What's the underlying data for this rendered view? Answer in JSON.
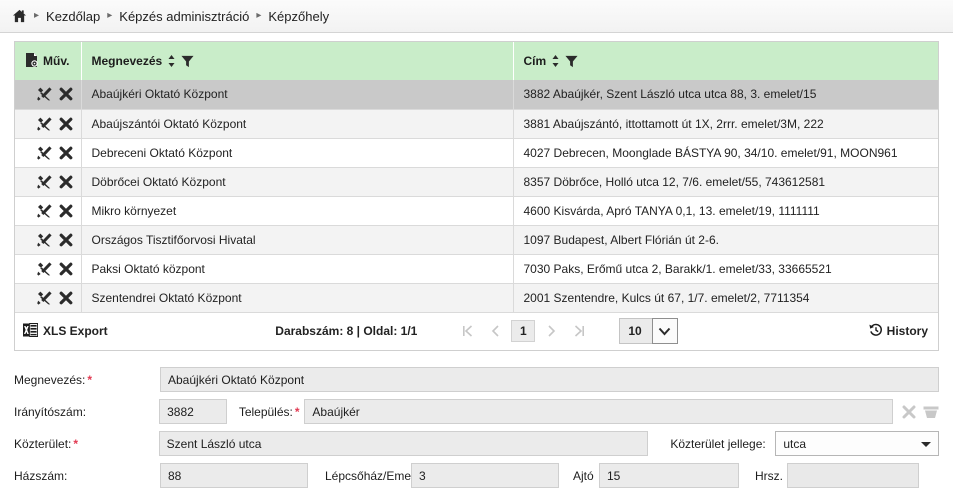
{
  "breadcrumb": {
    "home_icon": "home-icon",
    "items": [
      "Kezdőlap",
      "Képzés adminisztráció",
      "Képzőhely"
    ]
  },
  "grid": {
    "columns": [
      {
        "label": "Műv.",
        "icon": "page-settings-icon",
        "sortable": false,
        "filterable": false
      },
      {
        "label": "Megnevezés",
        "sortable": true,
        "filterable": true
      },
      {
        "label": "Cím",
        "sortable": true,
        "filterable": true
      }
    ],
    "row_actions": [
      "edit-tools-icon",
      "delete-x-icon"
    ],
    "rows": [
      {
        "name": "Abaújkéri Oktató Központ",
        "address": "3882 Abaújkér, Szent László utca utca 88, 3. emelet/15",
        "selected": true
      },
      {
        "name": "Abaújszántói Oktató Központ",
        "address": "3881 Abaújszántó, ittottamott út 1X, 2rrr. emelet/3M, 222",
        "selected": false
      },
      {
        "name": "Debreceni Oktató Központ",
        "address": "4027 Debrecen, Moonglade BÁSTYA 90, 34/10. emelet/91, MOON961",
        "selected": false
      },
      {
        "name": "Döbrőcei Oktató Központ",
        "address": "8357 Döbrőce, Holló utca 12, 7/6. emelet/55, 743612581",
        "selected": false
      },
      {
        "name": "Mikro környezet",
        "address": "4600 Kisvárda, Apró TANYA 0,1, 13. emelet/19, 1111111",
        "selected": false
      },
      {
        "name": "Országos Tisztifőorvosi Hivatal",
        "address": "1097 Budapest, Albert Flórián út 2-6.",
        "selected": false
      },
      {
        "name": "Paksi Oktató központ",
        "address": "7030 Paks, Erőmű utca 2, Barakk/1. emelet/33, 33665521",
        "selected": false
      },
      {
        "name": "Szentendrei Oktató Központ",
        "address": "2001 Szentendre, Kulcs út 67, 1/7. emelet/2, 7711354",
        "selected": false
      }
    ]
  },
  "footer": {
    "xls_export_label": "XLS Export",
    "xls_icon": "excel-icon",
    "count_label": "Darabszám: 8 | Oldal: 1/1",
    "pager": {
      "first": "|<",
      "prev": "<",
      "current_page": "1",
      "next": ">",
      "last": ">|"
    },
    "page_size": "10",
    "history_label": "History",
    "history_icon": "history-clock-icon"
  },
  "form": {
    "megnevezes": {
      "label": "Megnevezés:",
      "required": true,
      "value": "Abaújkéri Oktató Központ"
    },
    "iranyitoszam": {
      "label": "Irányítószám:",
      "required": false,
      "value": "3882"
    },
    "telepules": {
      "label": "Település:",
      "required": true,
      "value": "Abaújkér"
    },
    "telepules_actions": [
      "clear-x-icon",
      "trash-icon"
    ],
    "kozterulet": {
      "label": "Közterület:",
      "required": true,
      "value": "Szent László utca"
    },
    "kozterulet_jellege": {
      "label": "Közterület jellege:",
      "value": "utca"
    },
    "hazszam": {
      "label": "Házszám:",
      "required": false,
      "value": "88"
    },
    "lepcsohaz_emelet": {
      "label": "Lépcsőház/Emelet",
      "value": "3"
    },
    "ajto": {
      "label": "Ajtó",
      "value": "15"
    },
    "hrsz": {
      "label": "Hrsz.",
      "value": ""
    }
  },
  "colors": {
    "header_green": "#c9edc9",
    "selected_row": "#c9c9c9",
    "required_asterisk": "#e23a52",
    "field_bg": "#ebebeb"
  }
}
